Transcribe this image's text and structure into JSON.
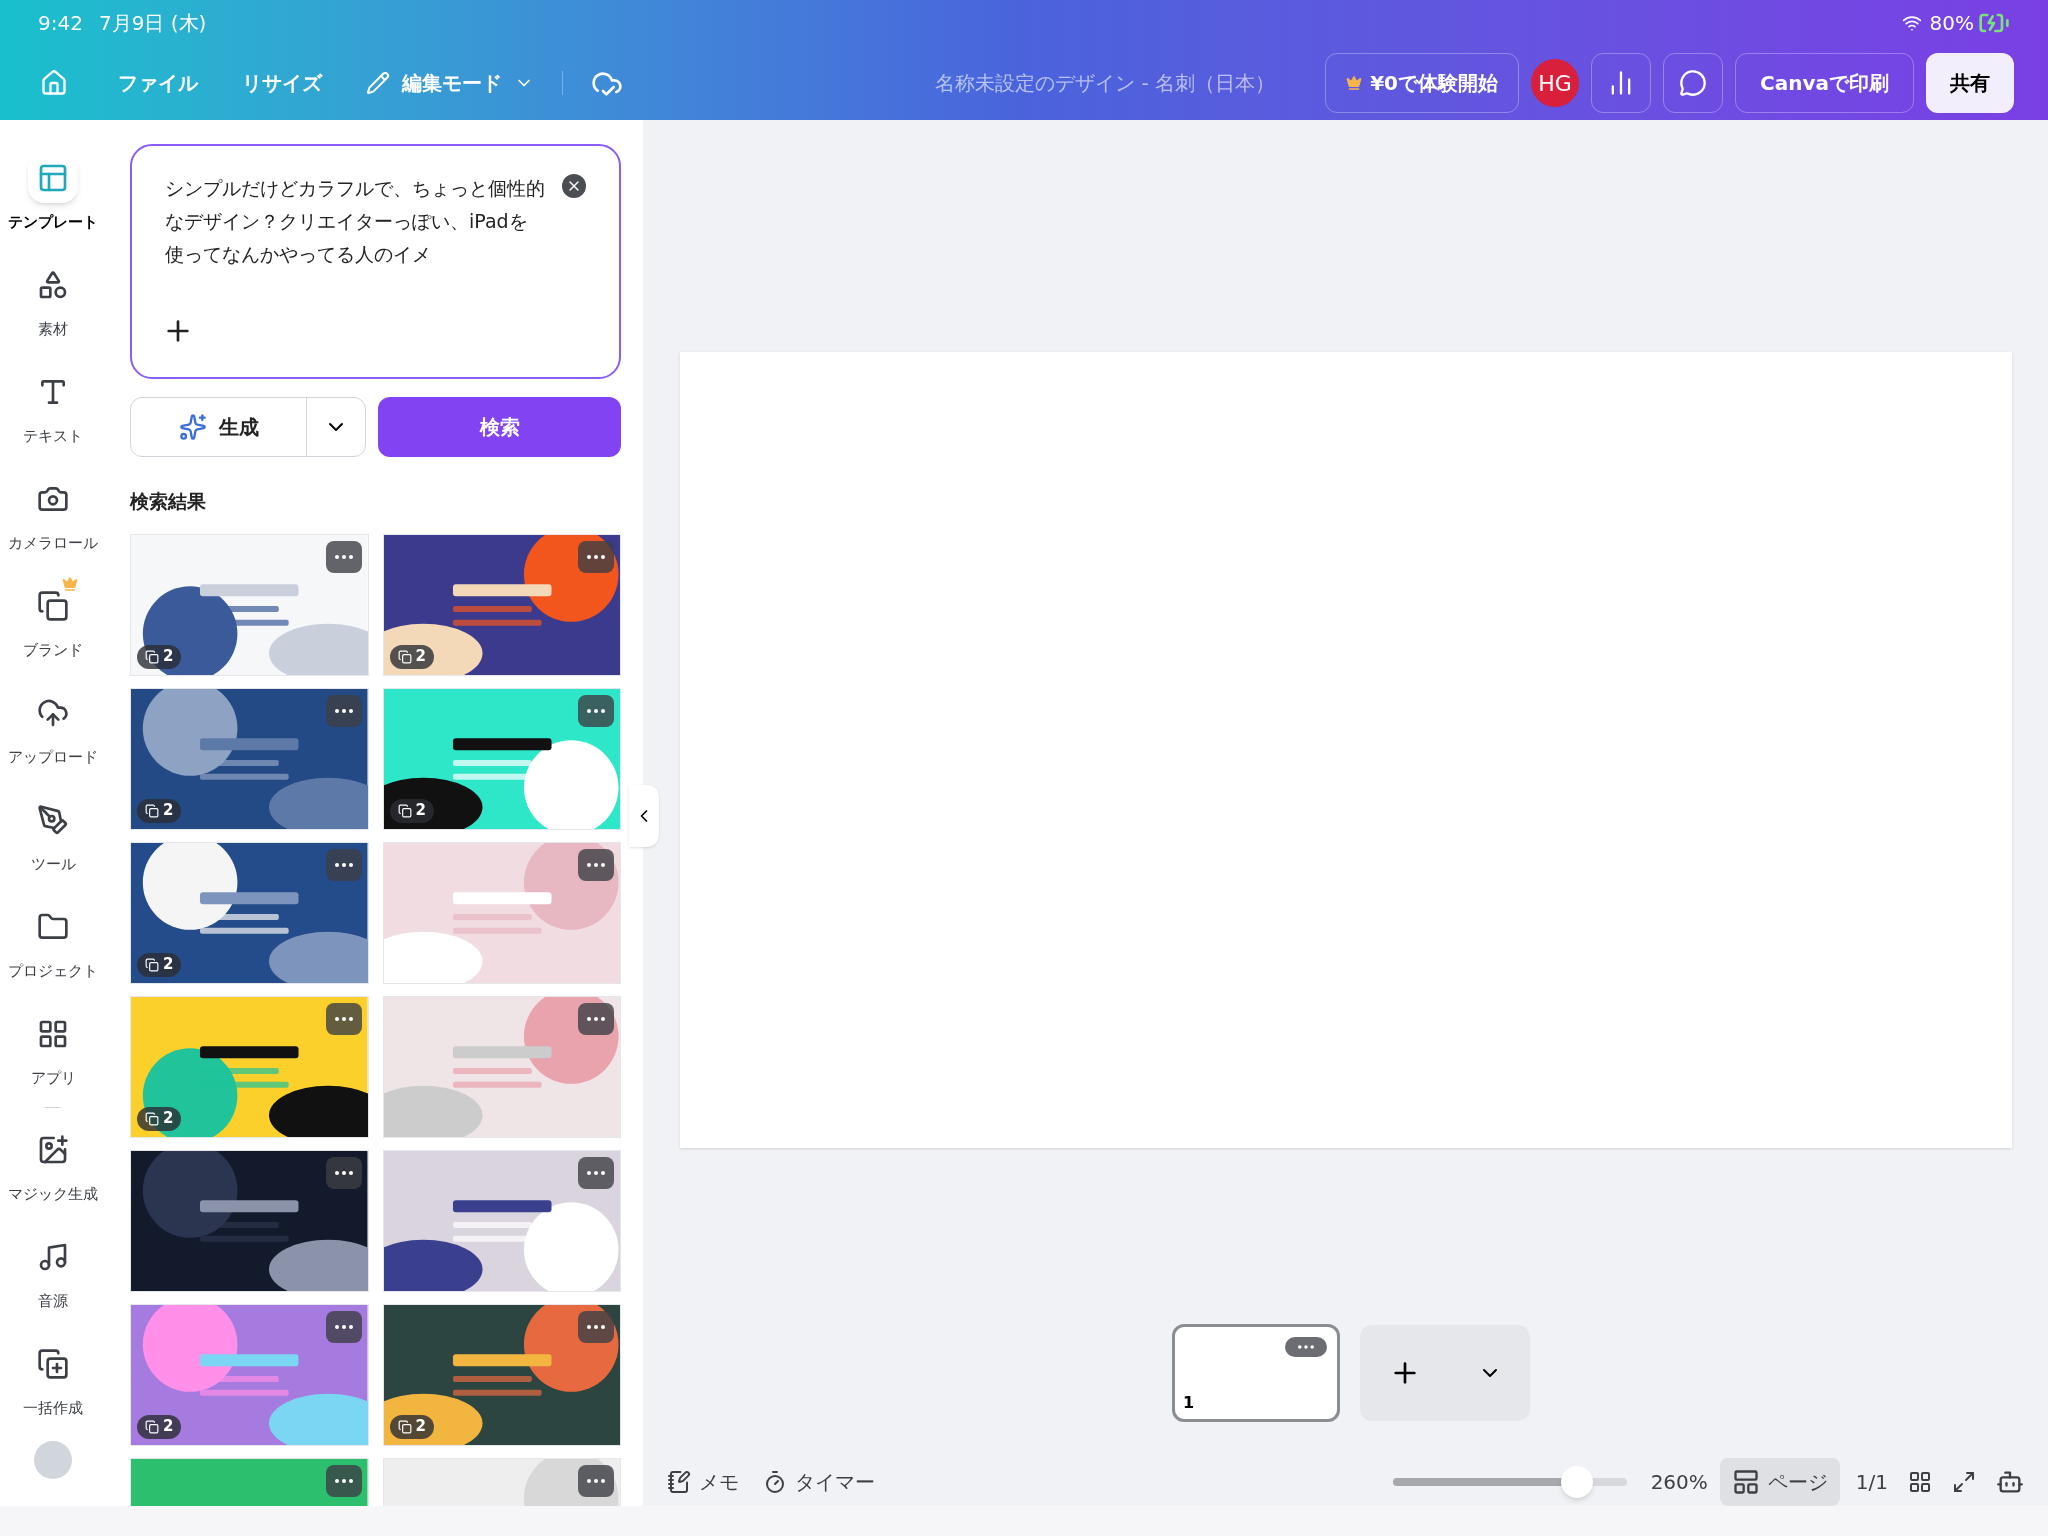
{
  "status_bar": {
    "time": "9:42",
    "date": "7月9日 (木)",
    "battery": "80%"
  },
  "toolbar": {
    "menus": [
      "ファイル",
      "リサイズ"
    ],
    "mode": "編集モード",
    "title": "名称未設定のデザイン - 名刺（日本）",
    "trial": "¥0で体験開始",
    "avatar": "HG",
    "print": "Canvaで印刷",
    "share": "共有"
  },
  "sidebar": {
    "items": [
      {
        "label": "テンプレート",
        "selected": true
      },
      {
        "label": "素材",
        "selected": false
      },
      {
        "label": "テキスト",
        "selected": false
      },
      {
        "label": "カメラロール",
        "selected": false
      },
      {
        "label": "ブランド",
        "selected": false,
        "premium": true
      },
      {
        "label": "アップロード",
        "selected": false
      },
      {
        "label": "ツール",
        "selected": false
      },
      {
        "label": "プロジェクト",
        "selected": false
      },
      {
        "label": "アプリ",
        "selected": false
      },
      {
        "label": "マジック生成",
        "selected": false
      },
      {
        "label": "音源",
        "selected": false
      },
      {
        "label": "一括作成",
        "selected": false
      }
    ]
  },
  "panel": {
    "prompt": "シンプルだけどカラフルで、ちょっと個性的なデザイン？クリエイターっぽい、iPadを使ってなんかやってる人のイメ",
    "generate": "生成",
    "search": "検索",
    "results_title": "検索結果",
    "templates": [
      {
        "kind": "picture",
        "pages": "2"
      },
      {
        "kind": "picture",
        "pages": "2"
      },
      {
        "kind": "picture",
        "pages": "2"
      },
      {
        "kind": "picture",
        "pages": "2"
      },
      {
        "kind": "picture",
        "pages": "2"
      },
      {
        "kind": "picture"
      },
      {
        "kind": "picture",
        "pages": "2"
      },
      {
        "kind": "picture"
      },
      {
        "kind": "picture"
      },
      {
        "kind": "picture"
      },
      {
        "kind": "picture",
        "pages": "2"
      },
      {
        "kind": "picture",
        "pages": "2"
      },
      {
        "kind": "picture"
      },
      {
        "kind": "picture"
      }
    ]
  },
  "pages": [
    {
      "number": "1",
      "selected": true
    }
  ],
  "bottom_bar": {
    "notes": "メモ",
    "timer": "タイマー",
    "zoom": {
      "level": 0.79
    },
    "zoom_reading": "260%",
    "view": "ページ",
    "page_count": "1/1"
  }
}
